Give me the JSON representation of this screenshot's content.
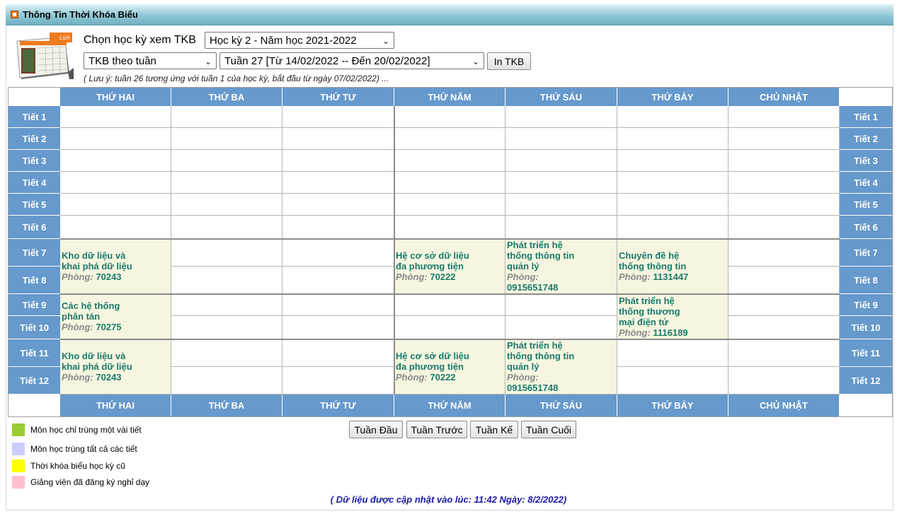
{
  "header": {
    "title": "Thông Tin Thời Khóa Biểu"
  },
  "calendar_icon": {
    "label": "Lịch"
  },
  "controls": {
    "semester_label": "Chọn học kỳ xem TKB",
    "semester_value": "Học kỳ 2 - Năm học 2021-2022",
    "view_value": "TKB theo tuần",
    "week_value": "Tuần 27 [Từ 14/02/2022 -- Đến 20/02/2022]",
    "print_label": "In TKB",
    "note": "( Lưu ý: tuần 26 tương ứng với tuần 1 của học kỳ, bắt đầu từ ngày 07/02/2022) ..."
  },
  "days": [
    "THỨ HAI",
    "THỨ BA",
    "THỨ TƯ",
    "THỨ NĂM",
    "THỨ SÁU",
    "THỨ BẢY",
    "CHỦ NHẬT"
  ],
  "periods": [
    "Tiết 1",
    "Tiết 2",
    "Tiết 3",
    "Tiết 4",
    "Tiết 5",
    "Tiết 6",
    "Tiết 7",
    "Tiết 8",
    "Tiết 9",
    "Tiết 10",
    "Tiết 11",
    "Tiết 12"
  ],
  "room_label": "Phòng:",
  "courses": [
    {
      "day": 0,
      "start": 6,
      "span": 2,
      "name_lines": [
        "Kho dữ liệu và",
        "khai phá dữ liệu"
      ],
      "room_inline": true,
      "room": "70243"
    },
    {
      "day": 3,
      "start": 6,
      "span": 2,
      "name_lines": [
        "Hệ cơ sở dữ liệu",
        "đa phương tiện"
      ],
      "room_inline": true,
      "room": "70222"
    },
    {
      "day": 4,
      "start": 6,
      "span": 2,
      "name_lines": [
        "Phát triển hệ",
        "thống thông tin",
        "quản lý"
      ],
      "room_inline": false,
      "room": "0915651748"
    },
    {
      "day": 5,
      "start": 6,
      "span": 2,
      "name_lines": [
        "Chuyên đề hệ",
        "thống thông tin"
      ],
      "room_inline": true,
      "room": "1131447"
    },
    {
      "day": 0,
      "start": 8,
      "span": 2,
      "name_lines": [
        "Các hệ thống",
        "phân tán"
      ],
      "room_inline": true,
      "room": "70275"
    },
    {
      "day": 5,
      "start": 8,
      "span": 2,
      "name_lines": [
        "Phát triển hệ",
        "thống thương",
        "mại điện tử"
      ],
      "room_inline": true,
      "room": "1116189"
    },
    {
      "day": 0,
      "start": 10,
      "span": 2,
      "name_lines": [
        "Kho dữ liệu và",
        "khai phá dữ liệu"
      ],
      "room_inline": true,
      "room": "70243"
    },
    {
      "day": 3,
      "start": 10,
      "span": 2,
      "name_lines": [
        "Hệ cơ sở dữ liệu",
        "đa phương tiện"
      ],
      "room_inline": true,
      "room": "70222"
    },
    {
      "day": 4,
      "start": 10,
      "span": 2,
      "name_lines": [
        "Phát triển hệ",
        "thống thông tin",
        "quản lý"
      ],
      "room_inline": false,
      "room": "0915651748"
    }
  ],
  "nav": {
    "first": "Tuần Đầu",
    "prev": "Tuần Trước",
    "next": "Tuần Kế",
    "last": "Tuần Cuối"
  },
  "legend": [
    {
      "color": "#99cc33",
      "text": "Môn học chỉ trùng một vài tiết"
    },
    {
      "color": "#ccccff",
      "text": "Môn học trùng tất cả các tiết"
    },
    {
      "color": "#ffff00",
      "text": "Thời khóa biểu học kỳ cũ"
    },
    {
      "color": "#ffc0cb",
      "text": "Giảng viên đã đăng ký nghỉ dạy"
    }
  ],
  "updated": "( Dữ liệu được cập nhật vào lúc: 11:42 Ngày: 8/2/2022)",
  "colors": {
    "header_blue": "#6699cc",
    "course_bg": "#f5f5e0",
    "course_text": "#1a7a6a",
    "update_text": "#1a1aa8"
  }
}
